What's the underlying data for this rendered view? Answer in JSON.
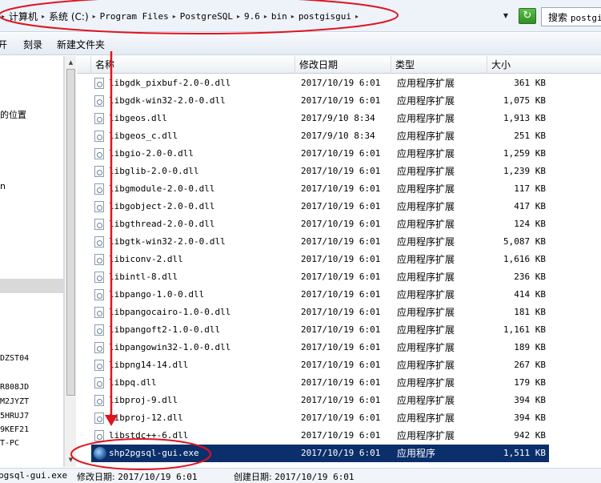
{
  "address_bar": {
    "crumbs": [
      "计算机",
      "系统 (C:)",
      "Program Files",
      "PostgreSQL",
      "9.6",
      "bin",
      "postgisgui"
    ],
    "search_label": "搜索",
    "search_value": "postgi"
  },
  "toolbar": {
    "items": [
      "开",
      "刻录",
      "新建文件夹"
    ]
  },
  "nav_pane": {
    "items": [
      "的位置",
      "n",
      "DZST04",
      "R808JD",
      "M2JYZT",
      "5HRUJ7",
      "9KEF21",
      "T-PC"
    ]
  },
  "columns": {
    "name": "名称",
    "date": "修改日期",
    "type": "类型",
    "size": "大小"
  },
  "files": [
    {
      "name": "libgdk_pixbuf-2.0-0.dll",
      "date": "2017/10/19 6:01",
      "type": "应用程序扩展",
      "size": "361 KB"
    },
    {
      "name": "libgdk-win32-2.0-0.dll",
      "date": "2017/10/19 6:01",
      "type": "应用程序扩展",
      "size": "1,075 KB"
    },
    {
      "name": "libgeos.dll",
      "date": "2017/9/10 8:34",
      "type": "应用程序扩展",
      "size": "1,913 KB"
    },
    {
      "name": "libgeos_c.dll",
      "date": "2017/9/10 8:34",
      "type": "应用程序扩展",
      "size": "251 KB"
    },
    {
      "name": "libgio-2.0-0.dll",
      "date": "2017/10/19 6:01",
      "type": "应用程序扩展",
      "size": "1,259 KB"
    },
    {
      "name": "libglib-2.0-0.dll",
      "date": "2017/10/19 6:01",
      "type": "应用程序扩展",
      "size": "1,239 KB"
    },
    {
      "name": "libgmodule-2.0-0.dll",
      "date": "2017/10/19 6:01",
      "type": "应用程序扩展",
      "size": "117 KB"
    },
    {
      "name": "libgobject-2.0-0.dll",
      "date": "2017/10/19 6:01",
      "type": "应用程序扩展",
      "size": "417 KB"
    },
    {
      "name": "libgthread-2.0-0.dll",
      "date": "2017/10/19 6:01",
      "type": "应用程序扩展",
      "size": "124 KB"
    },
    {
      "name": "libgtk-win32-2.0-0.dll",
      "date": "2017/10/19 6:01",
      "type": "应用程序扩展",
      "size": "5,087 KB"
    },
    {
      "name": "libiconv-2.dll",
      "date": "2017/10/19 6:01",
      "type": "应用程序扩展",
      "size": "1,616 KB"
    },
    {
      "name": "libintl-8.dll",
      "date": "2017/10/19 6:01",
      "type": "应用程序扩展",
      "size": "236 KB"
    },
    {
      "name": "libpango-1.0-0.dll",
      "date": "2017/10/19 6:01",
      "type": "应用程序扩展",
      "size": "414 KB"
    },
    {
      "name": "libpangocairo-1.0-0.dll",
      "date": "2017/10/19 6:01",
      "type": "应用程序扩展",
      "size": "181 KB"
    },
    {
      "name": "libpangoft2-1.0-0.dll",
      "date": "2017/10/19 6:01",
      "type": "应用程序扩展",
      "size": "1,161 KB"
    },
    {
      "name": "libpangowin32-1.0-0.dll",
      "date": "2017/10/19 6:01",
      "type": "应用程序扩展",
      "size": "189 KB"
    },
    {
      "name": "libpng14-14.dll",
      "date": "2017/10/19 6:01",
      "type": "应用程序扩展",
      "size": "267 KB"
    },
    {
      "name": "libpq.dll",
      "date": "2017/10/19 6:01",
      "type": "应用程序扩展",
      "size": "179 KB"
    },
    {
      "name": "libproj-9.dll",
      "date": "2017/10/19 6:01",
      "type": "应用程序扩展",
      "size": "394 KB"
    },
    {
      "name": "libproj-12.dll",
      "date": "2017/10/19 6:01",
      "type": "应用程序扩展",
      "size": "394 KB"
    },
    {
      "name": "libstdc++-6.dll",
      "date": "2017/10/19 6:01",
      "type": "应用程序扩展",
      "size": "942 KB"
    },
    {
      "name": "shp2pgsql-gui.exe",
      "date": "2017/10/19 6:01",
      "type": "应用程序",
      "size": "1,511 KB",
      "selected": true
    }
  ],
  "status_bar": {
    "filename": "pgsql-gui.exe",
    "modified_label": "修改日期:",
    "modified_value": "2017/10/19 6:01",
    "created_label": "创建日期:",
    "created_value": "2017/10/19 6:01"
  },
  "colors": {
    "selection": "#0b2f6b",
    "annotation": "#e0141e"
  },
  "icons": {
    "dll": "dll-file-icon",
    "exe": "exe-globe-icon",
    "refresh": "refresh-icon"
  }
}
